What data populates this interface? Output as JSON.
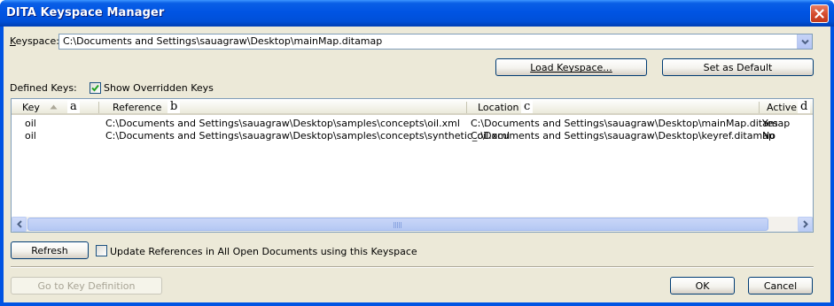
{
  "window": {
    "title": "DITA Keyspace Manager"
  },
  "keyspace": {
    "label": "Keyspace:",
    "value": "C:\\Documents and Settings\\sauagraw\\Desktop\\mainMap.ditamap"
  },
  "buttons": {
    "load_keyspace": "Load Keyspace...",
    "set_default": "Set as Default",
    "refresh": "Refresh",
    "go_to_key": "Go to Key Definition",
    "ok": "OK",
    "cancel": "Cancel"
  },
  "defined_keys_label": "Defined Keys:",
  "show_overridden": {
    "label": "Show Overridden Keys",
    "checked": true
  },
  "update_refs": {
    "label": "Update References in All Open Documents using this Keyspace",
    "checked": false
  },
  "table": {
    "columns": {
      "key": "Key",
      "reference": "Reference",
      "location": "Location",
      "active": "Active"
    },
    "annotations": {
      "a": "a",
      "b": "b",
      "c": "c",
      "d": "d"
    },
    "rows": [
      {
        "key": "oil",
        "reference": "C:\\Documents and Settings\\sauagraw\\Desktop\\samples\\concepts\\oil.xml",
        "location": "C:\\Documents and Settings\\sauagraw\\Desktop\\mainMap.ditamap",
        "active": "Yes"
      },
      {
        "key": "oil",
        "reference": "C:\\Documents and Settings\\sauagraw\\Desktop\\samples\\concepts\\synthetic_oil.xml",
        "location": "C:\\Documents and Settings\\sauagraw\\Desktop\\keyref.ditamap",
        "active": "No"
      }
    ]
  },
  "icons": {
    "close": "close-icon",
    "dropdown": "chevron-down-icon",
    "sort": "sort-ascending-icon",
    "scroll_left": "arrow-left-icon",
    "scroll_right": "arrow-right-icon",
    "check": "checkmark-icon"
  }
}
